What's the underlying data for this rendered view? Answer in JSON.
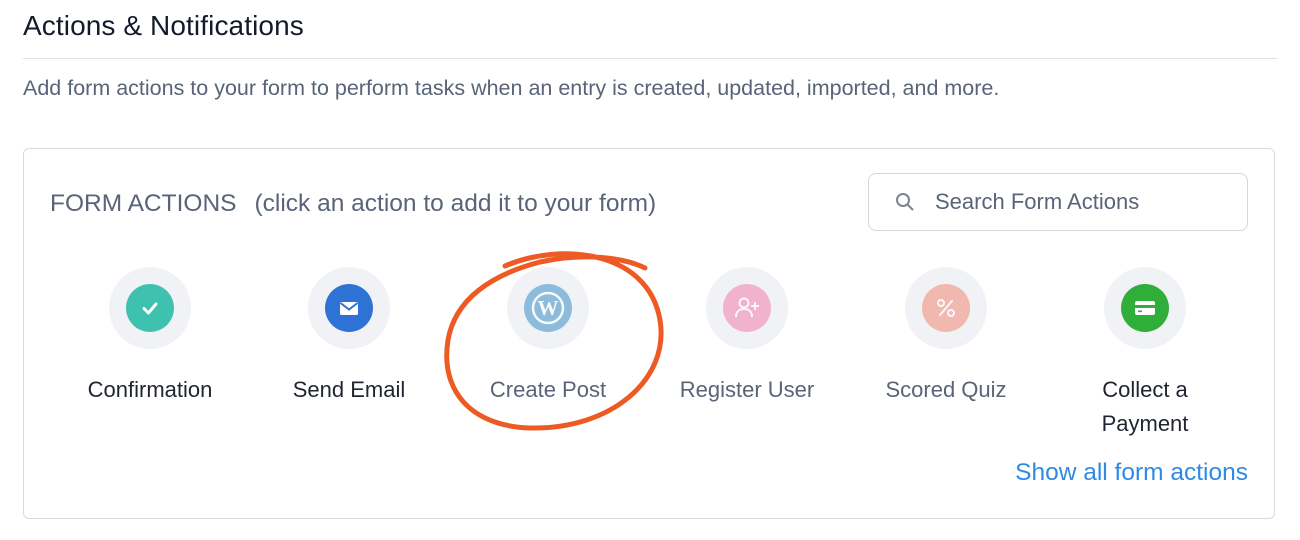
{
  "section": {
    "title": "Actions & Notifications",
    "description": "Add form actions to your form to perform tasks when an entry is created, updated, imported, and more."
  },
  "panel": {
    "heading": "FORM ACTIONS",
    "hint": "(click an action to add it to your form)",
    "search": {
      "placeholder": "Search Form Actions",
      "value": ""
    },
    "actions": [
      {
        "label": "Confirmation",
        "icon": "check-icon",
        "color": "#3fc1b0"
      },
      {
        "label": "Send Email",
        "icon": "envelope-icon",
        "color": "#2f72d6"
      },
      {
        "label": "Create Post",
        "icon": "wordpress-icon",
        "color": "#3b8fc8"
      },
      {
        "label": "Register User",
        "icon": "add-user-icon",
        "color": "#f07fb0"
      },
      {
        "label": "Scored Quiz",
        "icon": "percent-icon",
        "color": "#f28a76"
      },
      {
        "label": "Collect a Payment",
        "icon": "credit-card-icon",
        "color": "#2fae3a"
      }
    ],
    "show_all_label": "Show all form actions"
  },
  "colors": {
    "link": "#2f8ae6",
    "annotation": "#ee5a24"
  }
}
